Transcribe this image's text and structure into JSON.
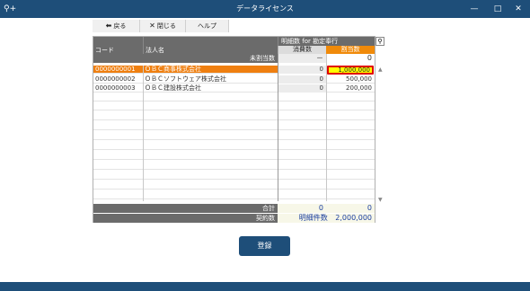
{
  "window": {
    "title": "データライセンス",
    "minimize_glyph": "—",
    "maximize_glyph": "□",
    "close_glyph": "✕",
    "app_glyph": "⚲+"
  },
  "toolbar": {
    "back_label": "戻る",
    "close_label": "閉じる",
    "help_label": "ヘルプ"
  },
  "grid": {
    "col_code": "コード",
    "col_name": "法人名",
    "group_header": "明細数 for 勘定奉行",
    "col_consumed": "消費数",
    "col_allocated": "割当数",
    "unallocated_label": "未割当数",
    "unallocated_consumed": "－",
    "unallocated_allocated": "0",
    "rows": [
      {
        "code": "0000000001",
        "name": "ＯＢＣ商事株式会社",
        "consumed": "0",
        "allocated": "1,000,000"
      },
      {
        "code": "0000000002",
        "name": "ＯＢＣソフトウェア株式会社",
        "consumed": "0",
        "allocated": "500,000"
      },
      {
        "code": "0000000003",
        "name": "ＯＢＣ建設株式会社",
        "consumed": "0",
        "allocated": "200,000"
      }
    ],
    "total_label": "合計",
    "total_consumed": "0",
    "total_allocated": "0",
    "contract_label": "契約数",
    "contract_item_label": "明細件数",
    "contract_value": "2,000,000"
  },
  "register_label": "登録",
  "colors": {
    "titlebar": "#1e4e79",
    "selected_row": "#ef7f10",
    "highlight_cell": "#ffff00",
    "highlight_border": "#e00000"
  }
}
